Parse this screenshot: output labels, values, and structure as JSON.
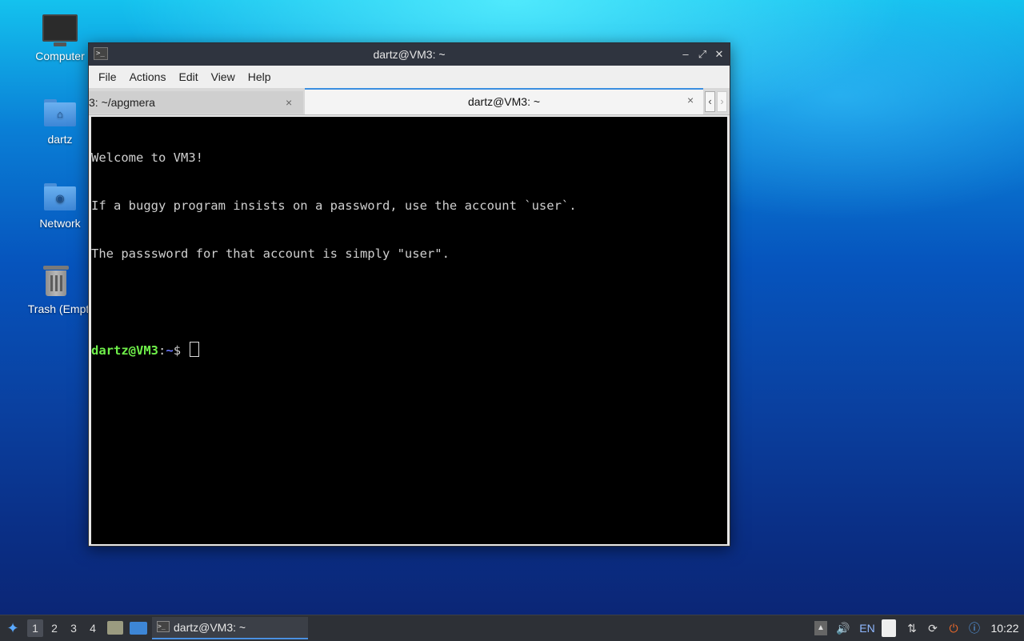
{
  "desktop": {
    "icons": [
      {
        "label": "Computer",
        "icon": "computer-icon"
      },
      {
        "label": "dartz",
        "icon": "home-folder-icon"
      },
      {
        "label": "Network",
        "icon": "network-folder-icon"
      },
      {
        "label": "Trash (Empt",
        "icon": "trash-icon"
      }
    ]
  },
  "window": {
    "title": "dartz@VM3: ~",
    "controls": {
      "minimize": "–",
      "maximize": "⤢",
      "close": "✕"
    },
    "menu": [
      "File",
      "Actions",
      "Edit",
      "View",
      "Help"
    ],
    "tabs": [
      {
        "label": "3: ~/apgmera",
        "active": false
      },
      {
        "label": "dartz@VM3: ~",
        "active": true
      }
    ],
    "tab_close": "×",
    "scroll_left": "‹",
    "scroll_right": "›"
  },
  "terminal": {
    "lines": [
      "Welcome to VM3!",
      "If a buggy program insists on a password, use the account `user`.",
      "The passsword for that account is simply \"user\".",
      ""
    ],
    "prompt_user": "dartz@VM3",
    "prompt_sep": ":",
    "prompt_path": "~",
    "prompt_symbol": "$ "
  },
  "taskbar": {
    "workspaces": [
      "1",
      "2",
      "3",
      "4"
    ],
    "active_workspace": "1",
    "task_label": "dartz@VM3: ~",
    "lang": "EN",
    "clock": "10:22"
  },
  "colors": {
    "prompt_user": "#6ff04a",
    "prompt_path": "#6a78ff",
    "active_tab_accent": "#3b8ee0"
  }
}
